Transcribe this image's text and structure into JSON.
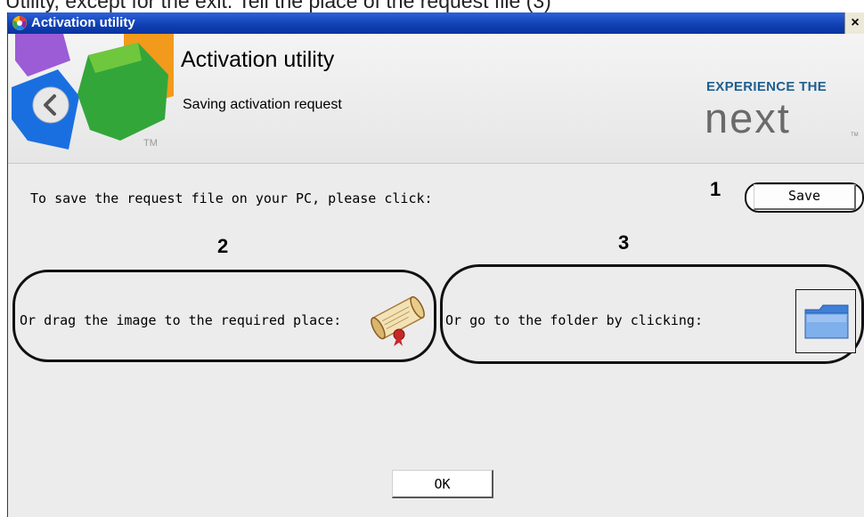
{
  "window": {
    "title": "Activation utility",
    "close_glyph": "×"
  },
  "header": {
    "title": "Activation utility",
    "subtitle": "Saving activation request",
    "logo_tm": "TM",
    "brand_tagline": "EXPERIENCE THE",
    "brand_name": "next",
    "brand_tm": "TM"
  },
  "content": {
    "save_prompt": "To save the request file on your PC, please click:",
    "save_button": "Save",
    "drag_prompt": "Or drag the image to the required place:",
    "folder_prompt": "Or go to the folder by clicking:",
    "ok_button": "OK"
  },
  "annotations": {
    "n1": "1",
    "n2": "2",
    "n3": "3"
  },
  "icons": {
    "logo": "intellect-logo",
    "back": "back-arrow-icon",
    "scroll": "scroll-icon",
    "folder": "folder-icon"
  },
  "colors": {
    "titlebar": "#0f3fb2",
    "brand_blue": "#1f5f90",
    "brand_gray": "#6a6a6a",
    "annotation": "#111111"
  }
}
